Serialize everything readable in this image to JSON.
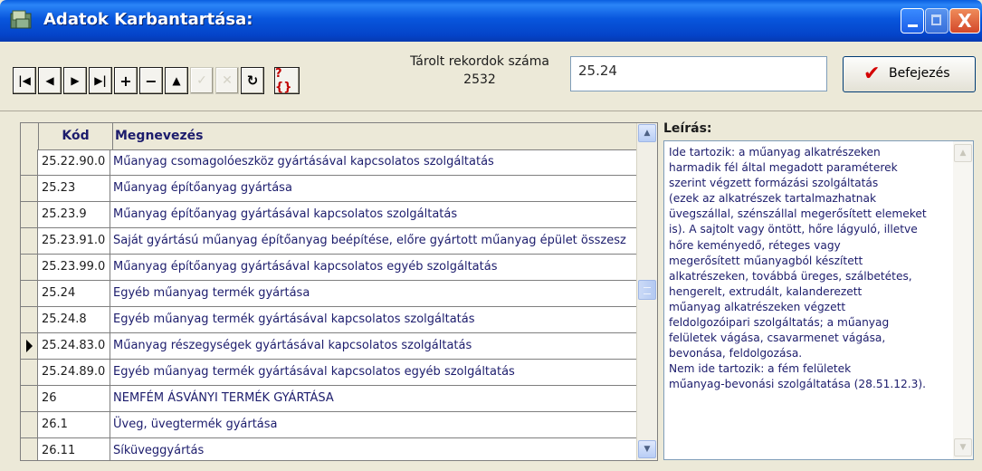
{
  "window": {
    "title": "Adatok Karbantartása:",
    "controls": {
      "close": "X"
    }
  },
  "toolbar": {
    "nav_buttons": [
      {
        "name": "first-record-button",
        "glyph": "|◀",
        "enabled": true
      },
      {
        "name": "prior-record-button",
        "glyph": "◀",
        "enabled": true
      },
      {
        "name": "next-record-button",
        "glyph": "▶",
        "enabled": true
      },
      {
        "name": "last-record-button",
        "glyph": "▶|",
        "enabled": true
      },
      {
        "name": "insert-record-button",
        "glyph": "+",
        "enabled": true
      },
      {
        "name": "delete-record-button",
        "glyph": "−",
        "enabled": true
      },
      {
        "name": "edit-record-button",
        "glyph": "▲",
        "enabled": true
      },
      {
        "name": "post-edit-button",
        "glyph": "✓",
        "enabled": false
      },
      {
        "name": "cancel-edit-button",
        "glyph": "✕",
        "enabled": false
      },
      {
        "name": "refresh-button",
        "glyph": "↻",
        "enabled": true
      },
      {
        "name": "help-button",
        "glyph": "?{}",
        "enabled": true
      }
    ],
    "record_count_label": "Tárolt rekordok száma",
    "record_count": "2532",
    "search_value": "25.24",
    "finish_label": "Befejezés"
  },
  "grid": {
    "columns": [
      "Kód",
      "Megnevezés"
    ],
    "rows": [
      {
        "code": "25.22.90.0",
        "name": "Műanyag csomagolóeszköz gyártásával kapcsolatos szolgáltatás",
        "current": false
      },
      {
        "code": "25.23",
        "name": "Műanyag építőanyag gyártása",
        "current": false
      },
      {
        "code": "25.23.9",
        "name": "Műanyag építőanyag gyártásával kapcsolatos szolgáltatás",
        "current": false
      },
      {
        "code": "25.23.91.0",
        "name": "Saját gyártású műanyag építőanyag beépítése, előre gyártott műanyag épület összesz",
        "current": false
      },
      {
        "code": "25.23.99.0",
        "name": "Műanyag építőanyag gyártásával kapcsolatos egyéb szolgáltatás",
        "current": false
      },
      {
        "code": "25.24",
        "name": "Egyéb műanyag termék gyártása",
        "current": false
      },
      {
        "code": "25.24.8",
        "name": "Egyéb műanyag termék gyártásával kapcsolatos szolgáltatás",
        "current": false
      },
      {
        "code": "25.24.83.0",
        "name": "Műanyag részegységek gyártásával kapcsolatos szolgáltatás",
        "current": true
      },
      {
        "code": "25.24.89.0",
        "name": "Egyéb műanyag termék gyártásával kapcsolatos egyéb szolgáltatás",
        "current": false
      },
      {
        "code": "26",
        "name": "NEMFÉM ÁSVÁNYI TERMÉK GYÁRTÁSA",
        "current": false
      },
      {
        "code": "26.1",
        "name": "Üveg, üvegtermék gyártása",
        "current": false
      },
      {
        "code": "26.11",
        "name": "Síküveggyártás",
        "current": false
      }
    ]
  },
  "description": {
    "title": "Leírás:",
    "lines": [
      "Ide tartozik: a műanyag alkatrészeken",
      "harmadik fél által megadott paraméterek",
      "szerint végzett formázási szolgáltatás",
      "(ezek az alkatrészek tartalmazhatnak",
      "üvegszállal, szénszállal megerősített elemeket",
      "is). A sajtolt vagy öntött, hőre lágyuló, illetve",
      "hőre keményedő, réteges vagy",
      "megerősített műanyagból készített",
      "alkatrészeken, továbbá üreges, szálbetétes,",
      "hengerelt, extrudált, kalanderezett",
      "műanyag alkatrészeken végzett",
      "feldolgozóipari szolgáltatás; a műanyag",
      "felületek vágása, csavarmenet vágása,",
      "bevonása, feldolgozása.",
      "Nem ide tartozik: a fém felületek",
      "műanyag-bevonási szolgáltatása (28.51.12.3)."
    ]
  },
  "colors": {
    "titlebar": "#0553d6",
    "face": "#ece9d8",
    "grid_text": "#1c1c6c",
    "finish_check": "#d40000"
  }
}
